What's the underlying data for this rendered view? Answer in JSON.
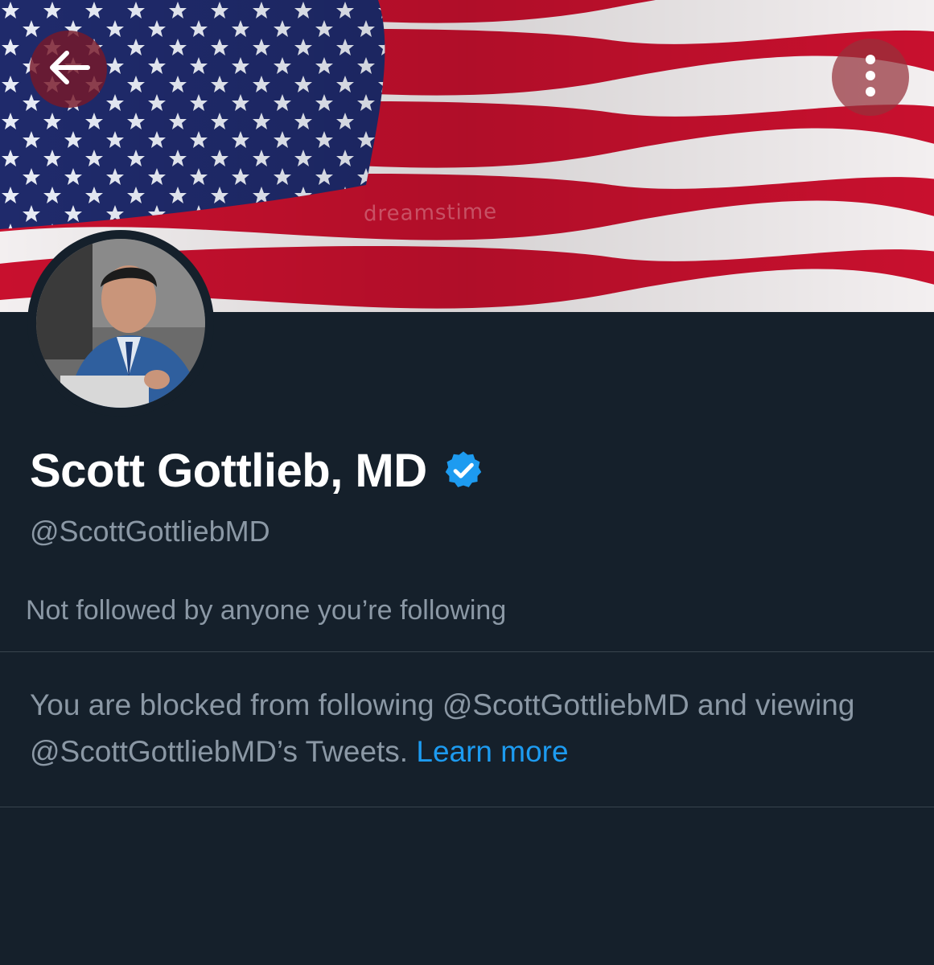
{
  "header": {
    "back_icon": "arrow-left-icon",
    "more_icon": "more-vertical-icon",
    "banner_watermark": "dreamstime"
  },
  "profile": {
    "name": "Scott Gottlieb, MD",
    "verified_icon": "verified-badge-icon",
    "handle": "@ScottGottliebMD",
    "followed_by": "Not followed by anyone you’re following"
  },
  "blocked_notice": {
    "text": "You are blocked from following @ScottGottliebMD and viewing @ScottGottliebMD’s Tweets.",
    "link_label": "Learn more"
  },
  "colors": {
    "background": "#15202b",
    "accent": "#1d9bf0",
    "secondary_text": "#8b98a5",
    "divider": "#38444d"
  }
}
